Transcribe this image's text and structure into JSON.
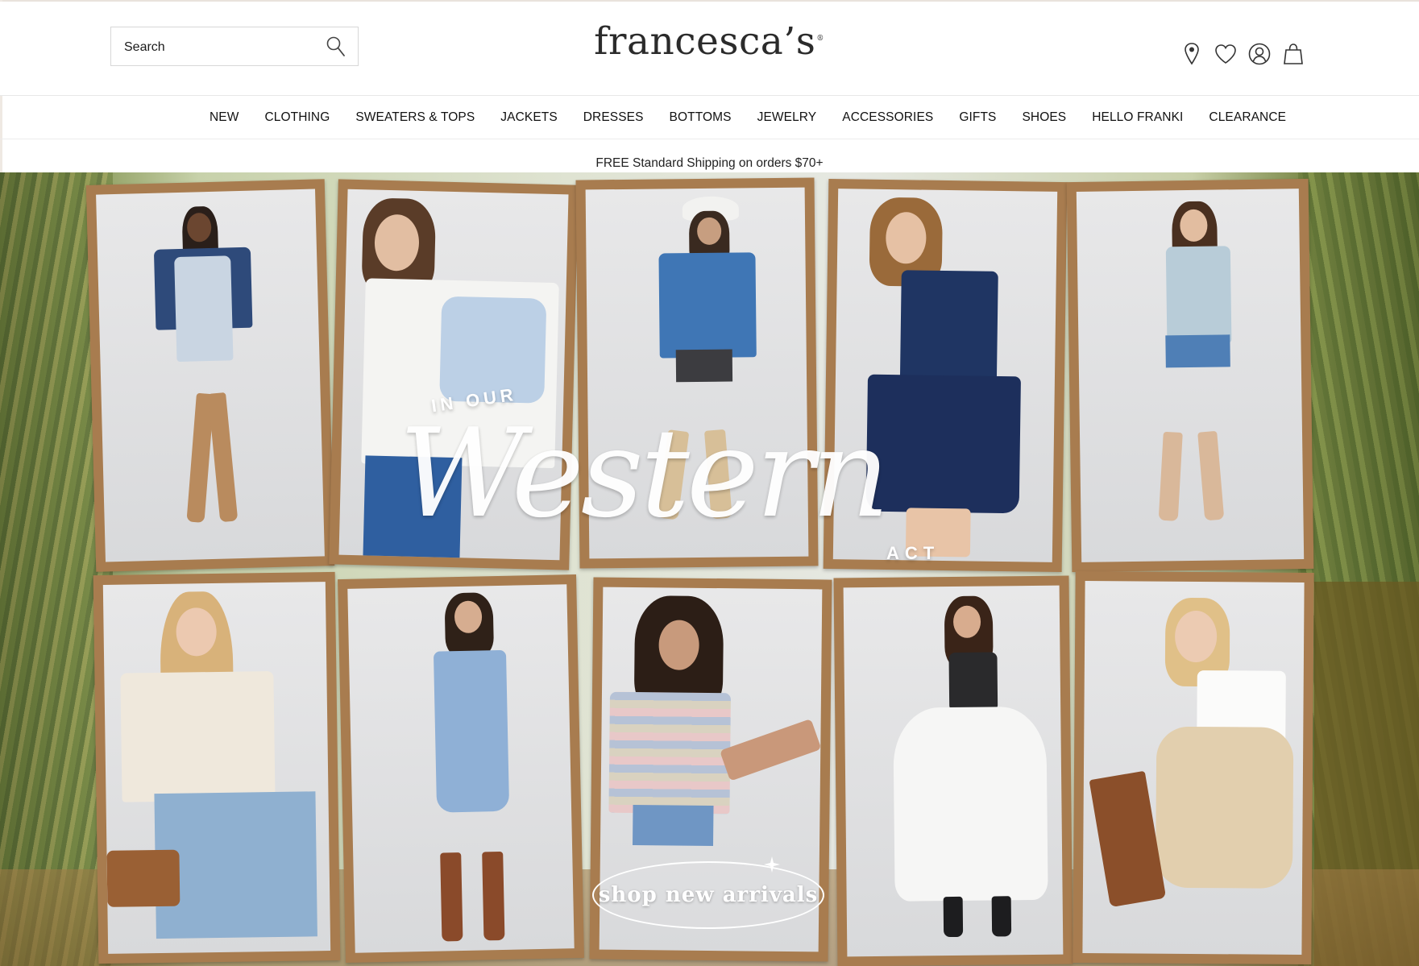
{
  "header": {
    "search_placeholder": "Search",
    "logo_text": "francesca’s",
    "logo_mark": "®",
    "icons": [
      "search-icon",
      "location-pin-icon",
      "heart-icon",
      "account-icon",
      "shopping-bag-icon"
    ]
  },
  "nav": {
    "items": [
      "NEW",
      "CLOTHING",
      "SWEATERS & TOPS",
      "JACKETS",
      "DRESSES",
      "BOTTOMS",
      "JEWELRY",
      "ACCESSORIES",
      "GIFTS",
      "SHOES",
      "HELLO FRANKI",
      "CLEARANCE"
    ]
  },
  "promo": {
    "text": "FREE Standard Shipping on orders $70+"
  },
  "hero": {
    "line1": "IN OUR",
    "line2": "Western",
    "line3": "ACT",
    "cta_label": "shop new arrivals"
  },
  "colors": {
    "frame": "#a87c4f",
    "text": "#1a1a1a",
    "hero_text": "#ffffff"
  }
}
